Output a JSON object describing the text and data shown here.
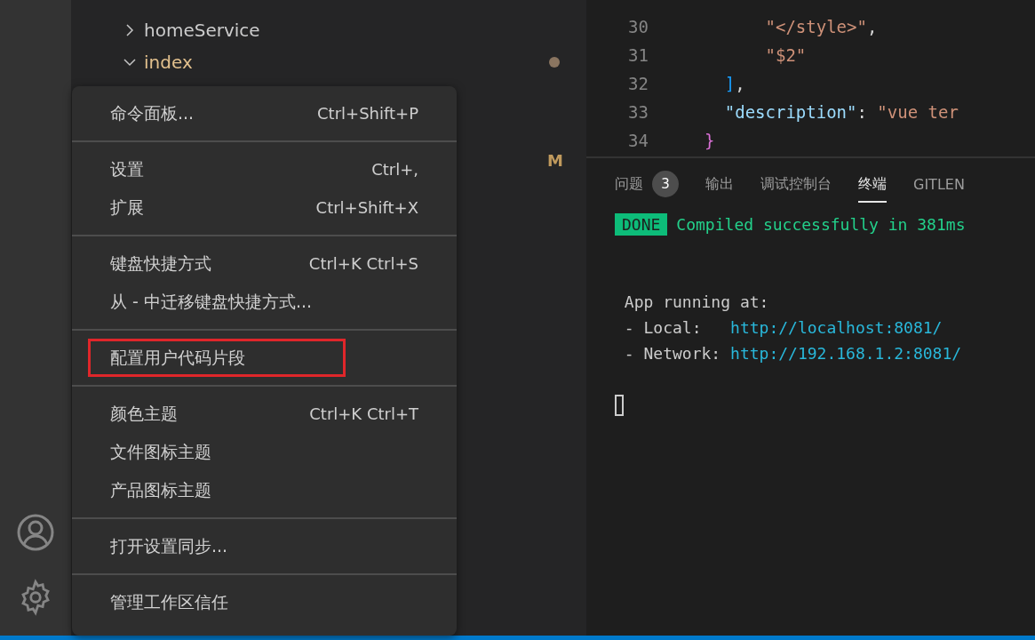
{
  "sidebar": {
    "tree": [
      {
        "label": "homeService",
        "expanded": false,
        "modified": false
      },
      {
        "label": "index",
        "expanded": true,
        "modified": true
      }
    ],
    "status_marks": [
      {
        "text": "M"
      }
    ]
  },
  "editor": {
    "lines": [
      {
        "number": "30",
        "tokens": [
          {
            "text": "        \"</style>\"",
            "kind": "string"
          },
          {
            "text": ",",
            "kind": "punct"
          }
        ]
      },
      {
        "number": "31",
        "tokens": [
          {
            "text": "        \"$2\"",
            "kind": "string"
          }
        ]
      },
      {
        "number": "32",
        "tokens": [
          {
            "text": "    ]",
            "kind": "bracket"
          },
          {
            "text": ",",
            "kind": "punct"
          }
        ]
      },
      {
        "number": "33",
        "tokens": [
          {
            "text": "    \"description\"",
            "kind": "key"
          },
          {
            "text": ": ",
            "kind": "punct"
          },
          {
            "text": "\"vue ter",
            "kind": "string"
          }
        ]
      },
      {
        "number": "34",
        "tokens": [
          {
            "text": "  }",
            "kind": "brace"
          }
        ]
      }
    ]
  },
  "panel": {
    "tabs": [
      {
        "label": "问题",
        "badge": "3",
        "selected": false
      },
      {
        "label": "输出",
        "selected": false
      },
      {
        "label": "调试控制台",
        "selected": false
      },
      {
        "label": "终端",
        "selected": true
      },
      {
        "label": "GITLEN",
        "selected": false
      }
    ],
    "terminal": {
      "status": "DONE",
      "message": "Compiled successfully in 381ms",
      "lines": [
        {
          "kind": "blank"
        },
        {
          "kind": "blank"
        },
        {
          "kind": "text",
          "text": " App running at:"
        },
        {
          "kind": "link",
          "label": " - Local:   ",
          "url": "http://localhost:8081/"
        },
        {
          "kind": "link",
          "label": " - Network: ",
          "url": "http://192.168.1.2:8081/"
        },
        {
          "kind": "blank"
        },
        {
          "kind": "cursor"
        }
      ]
    }
  },
  "menu": {
    "groups": [
      [
        {
          "label": "命令面板...",
          "shortcut": "Ctrl+Shift+P",
          "annotated": false
        }
      ],
      [
        {
          "label": "设置",
          "shortcut": "Ctrl+,",
          "annotated": false
        },
        {
          "label": "扩展",
          "shortcut": "Ctrl+Shift+X",
          "annotated": false
        }
      ],
      [
        {
          "label": "键盘快捷方式",
          "shortcut": "Ctrl+K Ctrl+S",
          "annotated": false
        },
        {
          "label": "从 - 中迁移键盘快捷方式...",
          "annotated": false
        }
      ],
      [
        {
          "label": "配置用户代码片段",
          "annotated": true
        }
      ],
      [
        {
          "label": "颜色主题",
          "shortcut": "Ctrl+K Ctrl+T",
          "annotated": false
        },
        {
          "label": "文件图标主题",
          "annotated": false
        },
        {
          "label": "产品图标主题",
          "annotated": false
        }
      ],
      [
        {
          "label": "打开设置同步...",
          "annotated": false
        }
      ],
      [
        {
          "label": "管理工作区信任",
          "annotated": false
        }
      ]
    ]
  }
}
